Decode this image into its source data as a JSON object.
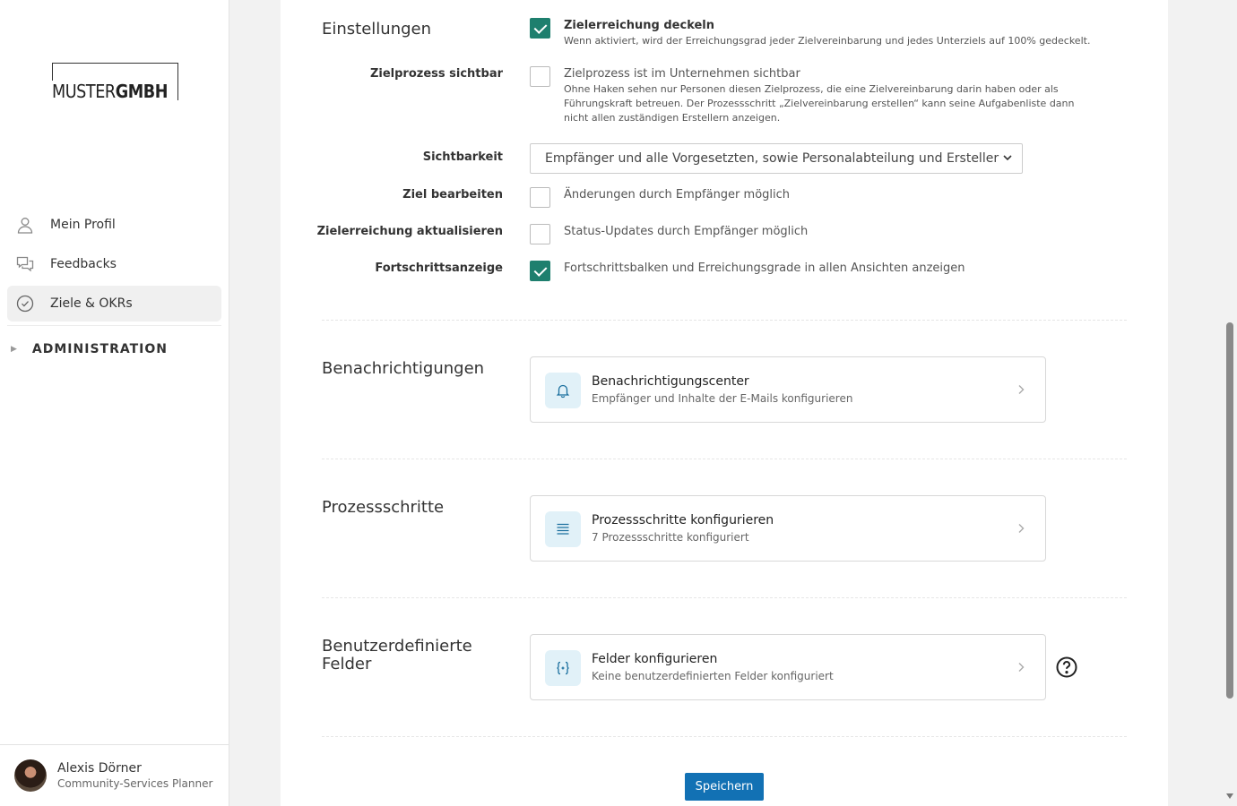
{
  "brand": {
    "logo_light": "MUSTER",
    "logo_bold": "GMBH"
  },
  "nav": {
    "items": [
      {
        "label": "Mein Profil",
        "icon": "user-icon"
      },
      {
        "label": "Feedbacks",
        "icon": "chat-icon"
      },
      {
        "label": "Ziele & OKRs",
        "icon": "check-circle-icon",
        "active": true
      }
    ],
    "admin_label": "ADMINISTRATION"
  },
  "user": {
    "name": "Alexis Dörner",
    "role": "Community-Services Planner"
  },
  "settings": {
    "title": "Einstellungen",
    "cap": {
      "checked": true,
      "label": "Zielerreichung deckeln",
      "description": "Wenn aktiviert, wird der Erreichungsgrad jeder Zielvereinbarung und jedes Unterziels auf 100% gedeckelt."
    },
    "visible": {
      "row_label": "Zielprozess sichtbar",
      "checked": false,
      "label": "Zielprozess ist im Unternehmen sichtbar",
      "description": "Ohne Haken sehen nur Personen diesen Zielprozess, die eine Zielvereinbarung darin haben oder als Führungskraft betreuen. Der Prozessschritt „Zielvereinbarung erstellen“ kann seine Aufgabenliste dann nicht allen zuständigen Erstellern anzeigen."
    },
    "visibility": {
      "row_label": "Sichtbarkeit",
      "selected": "Empfänger und alle Vorgesetzten, sowie Personalabteilung und Ersteller"
    },
    "edit": {
      "row_label": "Ziel bearbeiten",
      "checked": false,
      "label": "Änderungen durch Empfänger möglich"
    },
    "update": {
      "row_label": "Zielerreichung aktualisieren",
      "checked": false,
      "label": "Status-Updates durch Empfänger möglich"
    },
    "progress": {
      "row_label": "Fortschrittsanzeige",
      "checked": true,
      "label": "Fortschrittsbalken und Erreichungsgrade in allen Ansichten anzeigen"
    }
  },
  "notifications": {
    "title": "Benachrichtigungen",
    "card_title": "Benachrichtigungscenter",
    "card_sub": "Empfänger und Inhalte der E-Mails konfigurieren"
  },
  "steps": {
    "title": "Prozessschritte",
    "card_title": "Prozessschritte konfigurieren",
    "card_sub": "7 Prozessschritte konfiguriert"
  },
  "fields": {
    "title_line1": "Benutzerdefinierte",
    "title_line2": "Felder",
    "card_title": "Felder konfigurieren",
    "card_sub": "Keine benutzerdefinierten Felder konfiguriert"
  },
  "save_label": "Speichern",
  "colors": {
    "accent": "#1e7f6e",
    "primary_button": "#1271b4",
    "icon_bg": "#e1f1f8",
    "icon_fg": "#1a6f9e"
  }
}
